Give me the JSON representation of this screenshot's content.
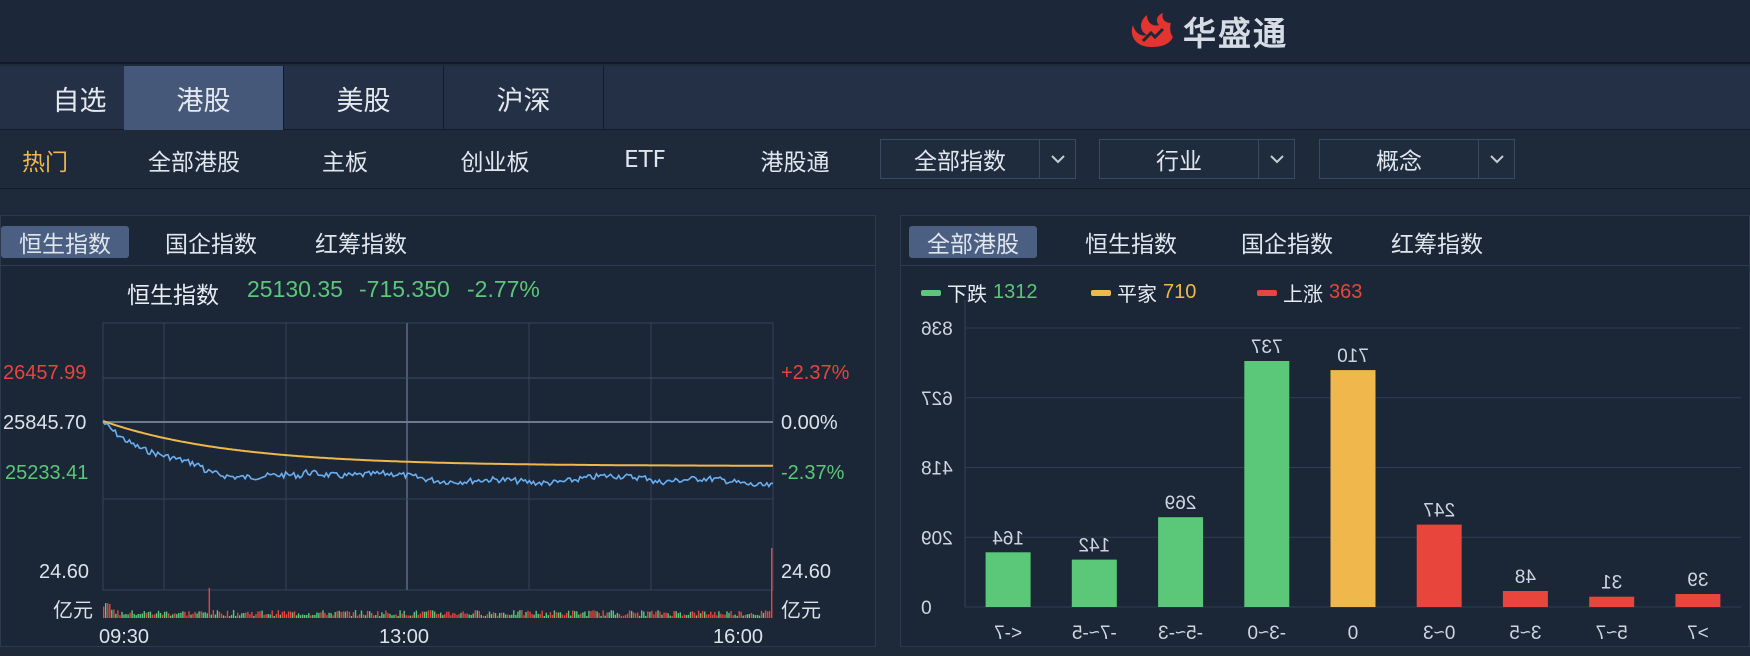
{
  "header": {
    "brand_name": "华盛通"
  },
  "market_tabs": [
    {
      "label": "自选"
    },
    {
      "label": "港股"
    },
    {
      "label": "美股"
    },
    {
      "label": "沪深"
    }
  ],
  "subnav": {
    "items": [
      "热门",
      "全部港股",
      "主板",
      "创业板",
      "ETF",
      "港股通"
    ],
    "dropdowns": [
      "全部指数",
      "行业",
      "概念"
    ]
  },
  "index_panel": {
    "tabs": [
      "恒生指数",
      "国企指数",
      "红筹指数"
    ],
    "summary_name": "恒生指数",
    "summary_value": "25130.35",
    "summary_change": "-715.350",
    "summary_pct": "-2.77%",
    "price_high": "26457.99",
    "price_mid": "25845.70",
    "price_low": "25233.41",
    "pct_high": "+2.37%",
    "pct_mid": "0.00%",
    "pct_low": "-2.37%",
    "volume_value": "24.60",
    "volume_unit": "亿元",
    "time_start": "09:30",
    "time_mid": "13:00",
    "time_end": "16:00",
    "colors": {
      "up": "#e8453c",
      "down": "#5ac878",
      "flat": "#dbe2ea",
      "price_line": "#6aaef0",
      "avg_line": "#f0b84c"
    }
  },
  "breadth_panel": {
    "tabs": [
      "全部港股",
      "恒生指数",
      "国企指数",
      "红筹指数"
    ],
    "legend": [
      {
        "label": "下跌",
        "count": "1312",
        "color": "#5ac878"
      },
      {
        "label": "平家",
        "count": "710",
        "color": "#f0b84c"
      },
      {
        "label": "上涨",
        "count": "363",
        "color": "#e8453c"
      }
    ]
  },
  "chart_data": {
    "type": "bar",
    "categories": [
      "<-7",
      "-7~-5",
      "-5~-3",
      "-3~0",
      "0",
      "0~3",
      "3~5",
      "5~7",
      ">7"
    ],
    "values": [
      164,
      142,
      269,
      737,
      710,
      247,
      48,
      31,
      39
    ],
    "value_labels": [
      "164",
      "142",
      "269",
      "737",
      "710",
      "247",
      "48",
      "31",
      "39"
    ],
    "ytick_labels": [
      "0",
      "209",
      "418",
      "627",
      "836"
    ],
    "ylim": [
      0,
      836
    ],
    "bar_colors": [
      "#5ac878",
      "#5ac878",
      "#5ac878",
      "#5ac878",
      "#f0b84c",
      "#e8453c",
      "#e8453c",
      "#e8453c",
      "#e8453c"
    ],
    "grid": true,
    "mirrored_text": true
  }
}
